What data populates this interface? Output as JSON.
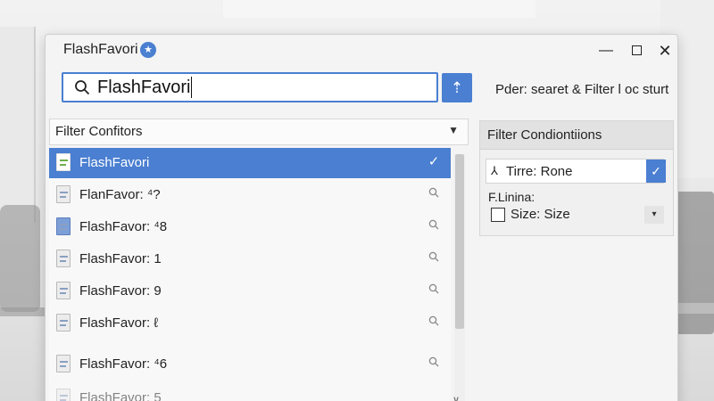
{
  "window": {
    "title": "FlashFavori",
    "title_badge": "★",
    "controls": {
      "minimize": "—",
      "close": "✕"
    }
  },
  "search": {
    "value": "FlashFavori",
    "action_icon": "⇡",
    "status_text": "Pder: searet & Filter l oc sturt"
  },
  "filter_header": {
    "label": "Filter Con​fitors",
    "caret": "▼"
  },
  "list": {
    "items": [
      {
        "label": "FlashFavori",
        "selected": true,
        "icon": "document-icon",
        "action": "✓"
      },
      {
        "label": "FlanFavor: ⁴?",
        "selected": false,
        "icon": "document-icon",
        "action": "search"
      },
      {
        "label": "FlashFavor: ⁴8",
        "selected": false,
        "icon": "folder-icon",
        "action": "search"
      },
      {
        "label": "FlashFavor: 1",
        "selected": false,
        "icon": "document-icon",
        "action": "search"
      },
      {
        "label": "FlashFavor: 9",
        "selected": false,
        "icon": "document-icon",
        "action": "search"
      },
      {
        "label": "FlashFavor: ℓ",
        "selected": false,
        "icon": "document-icon",
        "action": "search"
      },
      {
        "label": "FlashFavor: ⁴6",
        "selected": false,
        "icon": "document-icon",
        "action": "search"
      },
      {
        "label": "FlashFavor: 5",
        "selected": false,
        "icon": "document-icon",
        "action": "search"
      }
    ],
    "scroll_down": "∨"
  },
  "conditions": {
    "title": "Filter Condiontiions",
    "row1_label": "Tirre: Rone",
    "row1_icon": "person-icon",
    "row1_check": "✓",
    "sub_label": "F.Linina:",
    "size_label": "Size: Size",
    "dropdown_caret": "▾"
  },
  "colors": {
    "accent": "#4a7fd1"
  }
}
